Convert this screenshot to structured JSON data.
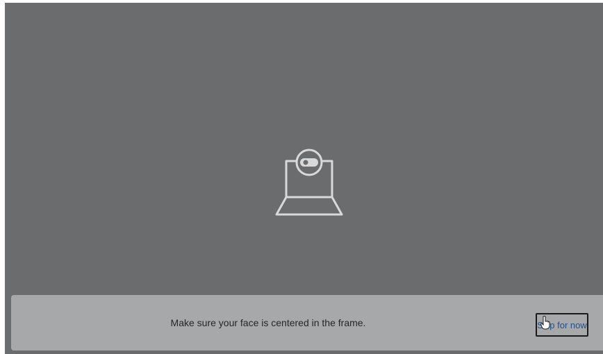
{
  "prompt": {
    "instruction_text": "Make sure your face is centered in the frame.",
    "skip_label": "Skip for now"
  },
  "icons": {
    "center_icon": "laptop-webcam-icon",
    "pointer": "hand-cursor-icon"
  },
  "colors": {
    "overlay_background": "#6b6c6e",
    "bottom_bar": "#a7a8aa",
    "icon_stroke": "#d9d9d9",
    "link_text": "#1d4f91"
  }
}
